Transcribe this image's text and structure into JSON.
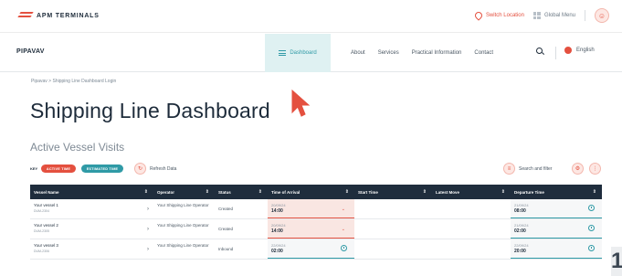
{
  "topbar": {
    "logo_text": "APM TERMINALS",
    "switch_location": "Switch Location",
    "global_menu": "Global Menu"
  },
  "nav": {
    "brand": "PIPAVAV",
    "dashboard": "Dashboard",
    "links": [
      "About",
      "Services",
      "Practical Information",
      "Contact"
    ],
    "language": "English"
  },
  "breadcrumb": "Pipavav > Shipping Line Dashboard Login",
  "page_title": "Shipping Line Dashboard",
  "section_title": "Active Vessel Visits",
  "toolbar": {
    "key_label": "KEY",
    "active_time": "ACTIVE TIME",
    "estimated_time": "ESTIMATED TIME",
    "refresh": "Refresh Data",
    "search_filter": "Search and filter"
  },
  "table": {
    "headers": [
      "Vessel Name",
      "Operator",
      "Status",
      "Time of Arrival",
      "Start Time",
      "Latest Move",
      "Departure Time"
    ],
    "rows": [
      {
        "vessel": "Your vessel 1",
        "code": "DUM-2304",
        "operator": "Your Shipping Line Operator",
        "status": "Created",
        "arr_date": "20/09/24",
        "arr_time": "14:00",
        "dep_date": "21/09/24",
        "dep_time": "08:00"
      },
      {
        "vessel": "Your vessel 2",
        "code": "DUM-2305",
        "operator": "Your Shipping Line Operator",
        "status": "Created",
        "arr_date": "20/09/24",
        "arr_time": "14:00",
        "dep_date": "21/09/24",
        "dep_time": "02:00"
      },
      {
        "vessel": "Your vessel 3",
        "code": "DUM-2306",
        "operator": "Your Shipping Line Operator",
        "status": "Inbound",
        "arr_date": "22/09/24",
        "arr_time": "02:00",
        "dep_date": "22/09/24",
        "dep_time": "20:00"
      }
    ]
  },
  "corner_digit": "1",
  "colors": {
    "accent": "#e4503f",
    "teal": "#2f9aa6",
    "header": "#1f2d3d"
  }
}
